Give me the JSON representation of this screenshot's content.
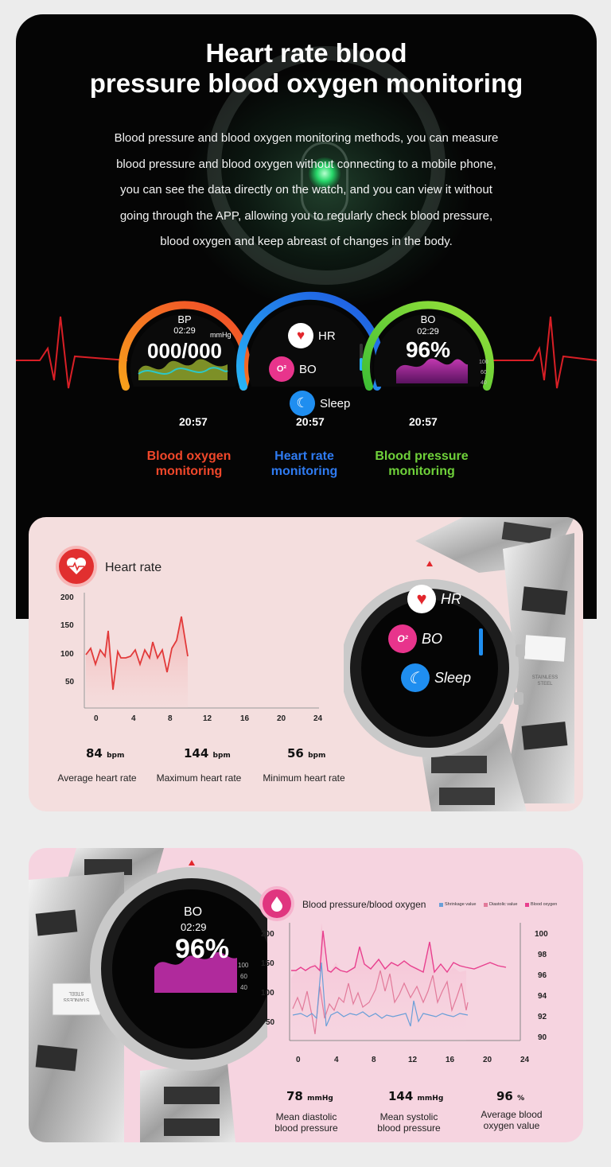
{
  "top": {
    "title_line1": "Heart rate blood",
    "title_line2": "pressure blood oxygen monitoring",
    "desc_lines": [
      "Blood pressure and blood oxygen monitoring methods, you can measure",
      "blood pressure and blood oxygen without connecting to a mobile phone,",
      "you can see the data directly on the watch, and you can view it without",
      "going through the APP, allowing you to regularly check blood pressure,",
      "blood oxygen and keep abreast of changes in the body."
    ]
  },
  "gauges": {
    "bp": {
      "label": "BP",
      "time": "02:29",
      "unit": "mmHg",
      "value": "000/000",
      "clock": "20:57",
      "caption_line1": "Blood oxygen",
      "caption_line2": "monitoring",
      "caption_color": "#f0472a"
    },
    "menu": {
      "items": [
        "HR",
        "BO",
        "Sleep"
      ],
      "clock": "20:57",
      "caption_line1": "Heart rate",
      "caption_line2": "monitoring",
      "caption_color": "#2f7bf1"
    },
    "bo": {
      "label": "BO",
      "time": "02:29",
      "value": "96%",
      "scale": [
        "100",
        "60",
        "40"
      ],
      "clock": "20:57",
      "caption_line1": "Blood pressure",
      "caption_line2": "monitoring",
      "caption_color": "#6fd13a"
    }
  },
  "card1": {
    "title": "Heart rate",
    "chart": {
      "y_ticks": [
        "200",
        "150",
        "100",
        "50"
      ],
      "x_ticks": [
        "0",
        "4",
        "8",
        "12",
        "16",
        "20",
        "24"
      ]
    },
    "stats": [
      {
        "value": "84",
        "unit": "bpm",
        "label": "Average heart rate"
      },
      {
        "value": "144",
        "unit": "bpm",
        "label": "Maximum heart rate"
      },
      {
        "value": "56",
        "unit": "bpm",
        "label": "Minimum heart rate"
      }
    ],
    "watch": {
      "items": [
        "HR",
        "BO",
        "Sleep"
      ],
      "band_text1": "STAINLESS",
      "band_text2": "STEEL"
    }
  },
  "card2": {
    "title": "Blood pressure/blood oxygen",
    "legend": [
      "Shrinkage value",
      "Diastolic value",
      "Blood oxygen"
    ],
    "colors": {
      "shrinkage": "#6a9fd8",
      "diastolic": "#e27a9a",
      "oxygen": "#e83f8e"
    },
    "chart": {
      "y_left": [
        "200",
        "150",
        "100",
        "50"
      ],
      "y_right": [
        "100",
        "98",
        "96",
        "94",
        "92",
        "90"
      ],
      "x_ticks": [
        "0",
        "4",
        "8",
        "12",
        "16",
        "20",
        "24"
      ]
    },
    "stats": [
      {
        "value": "78",
        "unit": "mmHg",
        "label1": "Mean diastolic",
        "label2": "blood pressure"
      },
      {
        "value": "144",
        "unit": "mmHg",
        "label1": "Mean systolic",
        "label2": "blood pressure"
      },
      {
        "value": "96",
        "unit": "%",
        "label1": "Average blood",
        "label2": "oxygen value"
      }
    ],
    "watch": {
      "label": "BO",
      "time": "02:29",
      "value": "96%",
      "scale": [
        "100",
        "60",
        "40"
      ],
      "band_text1": "STAINLESS",
      "band_text2": "STEEL"
    }
  }
}
